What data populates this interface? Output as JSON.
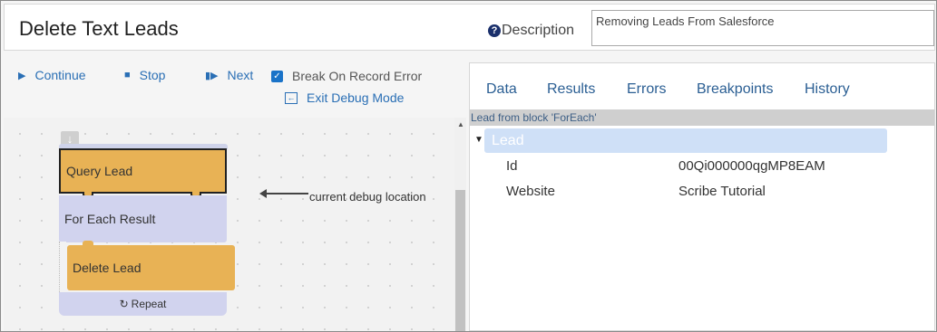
{
  "header": {
    "title": "Delete Text Leads",
    "description_label": "Description",
    "description_value": "Removing Leads From Salesforce"
  },
  "toolbar": {
    "continue_label": "Continue",
    "stop_label": "Stop",
    "next_label": "Next",
    "break_on_error_label": "Break On Record Error",
    "break_on_error_checked": true,
    "exit_debug_label": "Exit Debug Mode"
  },
  "canvas": {
    "blocks": {
      "query": "Query Lead",
      "foreach": "For Each Result",
      "delete": "Delete Lead",
      "repeat": "Repeat"
    },
    "debug_annotation": "current debug location"
  },
  "panel": {
    "tabs": [
      "Data",
      "Results",
      "Errors",
      "Breakpoints",
      "History"
    ],
    "section_title": "Lead from block 'ForEach'",
    "tree_root": "Lead",
    "fields": [
      {
        "key": "Id",
        "value": "00Qi000000qgMP8EAM"
      },
      {
        "key": "Website",
        "value": "Scribe Tutorial"
      }
    ]
  },
  "colors": {
    "link": "#2a6fb5",
    "block_orange": "#e8b255",
    "block_lavender": "#d1d3ee",
    "tree_highlight": "#cfe0f7"
  },
  "icons": {
    "continue": "play-icon",
    "stop": "stop-icon",
    "next": "step-next-icon",
    "exit": "exit-icon",
    "help": "help-icon",
    "repeat": "repeat-icon",
    "collapse": "caret-down-icon"
  }
}
